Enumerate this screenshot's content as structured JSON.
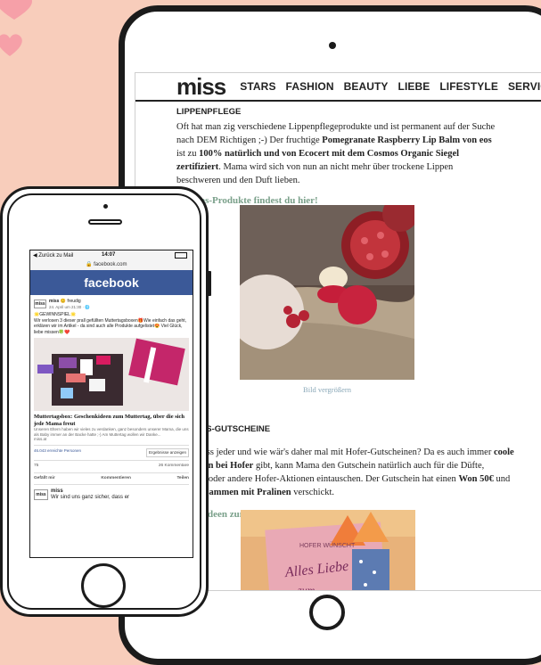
{
  "tablet": {
    "logo": "miss",
    "nav": [
      "STARS",
      "FASHION",
      "BEAUTY",
      "LIEBE",
      "LIFESTYLE",
      "SERVICE"
    ],
    "article1": {
      "heading": "LIPPENPFLEGE",
      "p_a": "Oft hat man zig verschiedene Lippenpflegeprodukte und ist permanent auf der Suche nach DEM Richtigen ;-) Der fruchtige ",
      "p_b": "Pomegranate Raspberry Lip Balm von eos",
      "p_c": " ist zu ",
      "p_d": "100% natürlich und von Ecocert mit dem Cosmos Organic Siegel zertifiziert",
      "p_e": ". Mama wird sich von nun an nicht mehr über trockene Lippen beschweren und den Duft lieben.",
      "link": "Alle eos-Produkte findest du hier!"
    },
    "caption": "Bild vergrößern",
    "article2": {
      "heading": "HOFERS-GUTSCHEINE",
      "p_a": "...en muss jeder und wie wär's daher mal mit Hofer-Gutscheinen? Da es auch immer ",
      "p_b": "coole Aktionen bei Hofer",
      "p_c": " gibt, kann Mama den Gutschein natürlich auch für ",
      "p_d": "die Düfte, Fashion oder andere Hofer-Aktionen eintauschen. Der Gutschein hat einen ",
      "p_e": "Won 50€",
      "p_f": " und wird ",
      "p_g": "zusammen mit Pralinen",
      "p_h": " verschickt.",
      "link": "Hofer-Ideen zum Muttertag gibt's hier!"
    },
    "photo2_text": [
      "HOFER WÜNSCHT",
      "Alles Liebe",
      "zum"
    ]
  },
  "phone": {
    "status": {
      "back": "◀ Zurück zu Mail",
      "time": "14:07",
      "url": "🔒 facebook.com"
    },
    "fb_title": "facebook",
    "post": {
      "page": "miss",
      "feeling": "😊 freudig",
      "date": "24. April um 21:30 · 🌐",
      "line1": "🌟GEWINNSPIEL🌟",
      "line2": "Wir verlosen 3 dieser prall gefüllten Muttertagsboxen🎁Wie einfach das geht, erklären wir im Artikel - da sind auch alle Produkte aufgelistet😍 Viel Glück, liebe missen🍀❤️",
      "link_title": "Muttertagsbox: Geschenkideen zum Muttertag, über die sich jede Mama freut",
      "link_desc": "Unseren Eltern haben wir vieles zu verdanken, ganz besonders unserer Mama, die uns als Baby immer an der Backe hatte ;-) Am Muttertag wollen wir Danke...",
      "link_domain": "miss.at",
      "reach": "46.043 erreichte Personen",
      "results_btn": "Ergebnisse anzeigen",
      "reactions": "75",
      "comments": "26 Kommentare",
      "like": "Gefällt mir",
      "comment": "Kommentieren",
      "share": "Teilen"
    },
    "comment": {
      "author": "miss",
      "text": "Wir sind uns ganz sicher, dass er"
    }
  },
  "colors": {
    "background": "#f8cdbb",
    "facebook": "#3b5998",
    "link_green": "#7aa08a",
    "heart": "#f6a0a8"
  }
}
